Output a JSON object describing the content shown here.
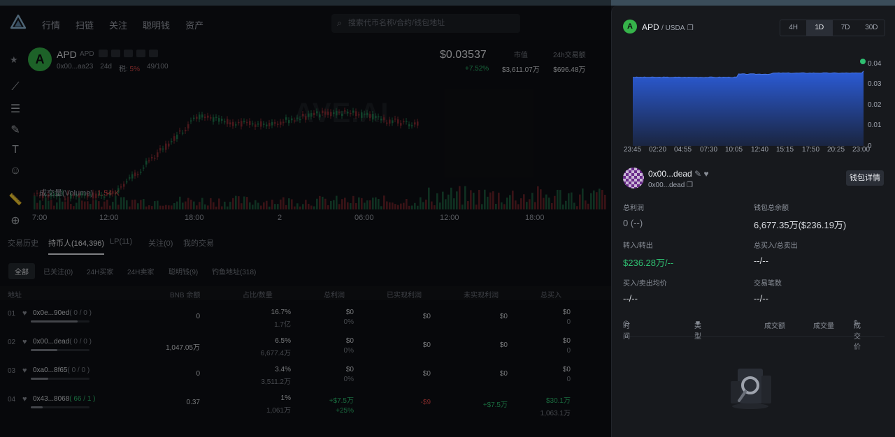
{
  "nav": {
    "items": [
      "行情",
      "扫链",
      "关注",
      "聪明钱",
      "资产"
    ]
  },
  "search": {
    "placeholder": "搜索代币名称/合约/钱包地址"
  },
  "token": {
    "avatar_letter": "A",
    "name": "APD",
    "symbol": "APD",
    "address": "0x00...aa23",
    "age": "24d",
    "tax_label": "税:",
    "tax": "5%",
    "score": "49",
    "score_max": "/100",
    "price": "$0.03537",
    "change": "+7.52%",
    "stats": [
      {
        "label": "市值",
        "value": "$3,611.07万"
      },
      {
        "label": "24h交易额",
        "value": "$696.48万"
      }
    ]
  },
  "chart": {
    "watermark": "AVE.AI",
    "volume_label": "成交量(Volume)",
    "volume_value": "1.54 K",
    "time_ticks": [
      "7:00",
      "12:00",
      "18:00",
      "2",
      "06:00",
      "12:00",
      "18:00"
    ]
  },
  "tabs": [
    "交易历史",
    "持币人(164,396)",
    "LP(11)",
    "关注(0)",
    "我的交易"
  ],
  "subtabs": [
    "全部",
    "已关注(0)",
    "24H买家",
    "24H卖家",
    "聪明钱(9)",
    "钓鱼地址(318)"
  ],
  "table": {
    "headers": [
      "地址",
      "BNB 余额",
      "占比/数量",
      "总利润",
      "已实现利润",
      "未实现利润",
      "总买入"
    ],
    "rows": [
      {
        "num": "01",
        "addr": "0x0e...90ed",
        "tx": "( 0 / 0 )",
        "bnb": "0",
        "pct": "16.7%",
        "qty": "1.7亿",
        "tp": "$0",
        "tpp": "0%",
        "rp": "$0",
        "up": "$0",
        "buy": "$0",
        "buyq": "0",
        "bar": 0.8
      },
      {
        "num": "02",
        "addr": "0x00...dead",
        "tx": "( 0 / 0 )",
        "bnb": "1,047.05万",
        "pct": "6.5%",
        "qty": "6,677.4万",
        "tp": "$0",
        "tpp": "0%",
        "rp": "$0",
        "up": "$0",
        "buy": "$0",
        "buyq": "0",
        "bar": 0.45
      },
      {
        "num": "03",
        "addr": "0xa0...8f65",
        "tx": "( 0 / 0 )",
        "bnb": "0",
        "pct": "3.4%",
        "qty": "3,511.2万",
        "tp": "$0",
        "tpp": "0%",
        "rp": "$0",
        "up": "$0",
        "buy": "$0",
        "buyq": "0",
        "bar": 0.3
      },
      {
        "num": "04",
        "addr": "0x43...8068",
        "tx": "( 66 / 1 )",
        "bnb": "0.37",
        "pct": "1%",
        "qty": "1,061万",
        "tp": "+$7.5万",
        "tpp": "+25%",
        "rp": "-$9",
        "up": "+$7.5万",
        "buy": "$30.1万",
        "buyq": "1,063.1万",
        "bar": 0.2
      }
    ]
  },
  "panel": {
    "avatar_letter": "A",
    "pair_base": "APD",
    "pair_quote": "/ USDA",
    "intervals": [
      "4H",
      "1D",
      "7D",
      "30D"
    ],
    "active_interval": "1D",
    "y_ticks": [
      "0.04",
      "0.03",
      "0.02",
      "0.01",
      "0"
    ],
    "x_ticks": [
      "23:45",
      "02:20",
      "04:55",
      "07:30",
      "10:05",
      "12:40",
      "15:15",
      "17:50",
      "20:25",
      "23:00"
    ],
    "wallet_name": "0x00...dead",
    "wallet_sub": "0x00...dead",
    "wallet_button": "钱包详情",
    "fields": [
      {
        "label": "总利润",
        "value": "0 (--)"
      },
      {
        "label": "钱包总余额",
        "value": "6,677.35万($236.19万)"
      },
      {
        "label": "转入/转出",
        "value": "$236.28万/--"
      },
      {
        "label": "总买入/总卖出",
        "value": "--/--"
      },
      {
        "label": "买入/卖出均价",
        "value": "--/--"
      },
      {
        "label": "交易笔数",
        "value": "--/--"
      }
    ],
    "trade_headers": [
      "时间",
      "类型",
      "成交额",
      "成交量",
      "成交价"
    ],
    "accent": "#2fbf71"
  }
}
